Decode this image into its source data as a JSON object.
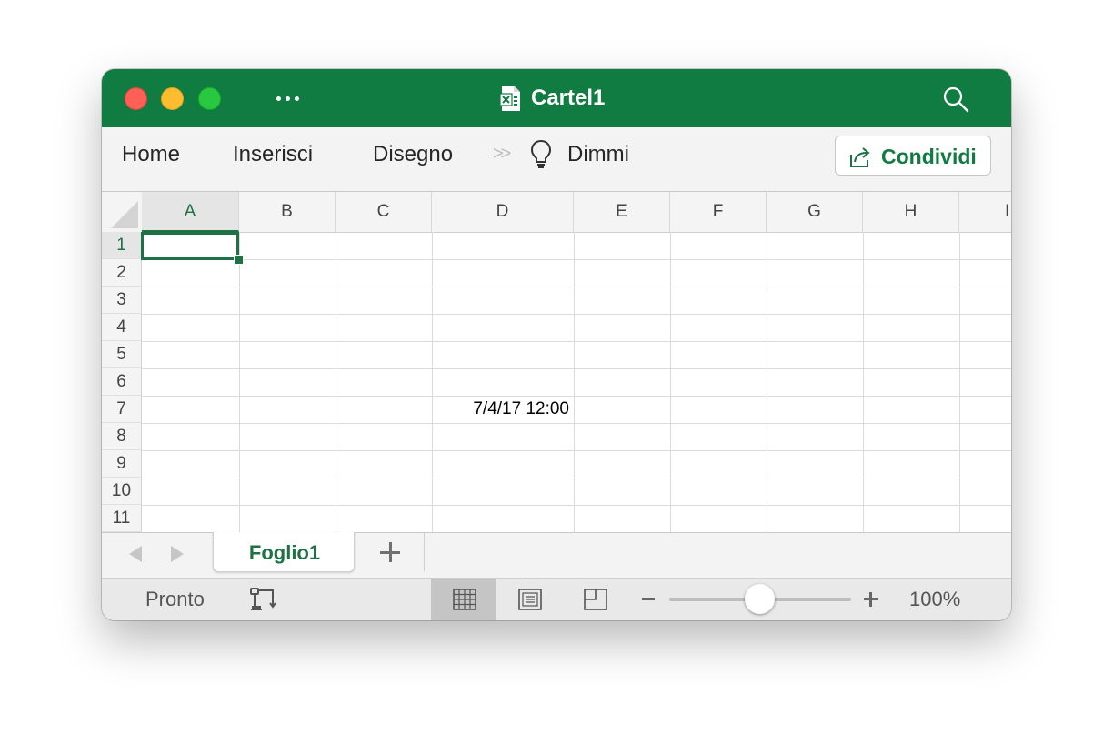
{
  "window": {
    "title": "Cartel1"
  },
  "ribbon": {
    "tabs": [
      "Home",
      "Inserisci",
      "Disegno"
    ],
    "more_chevron": "»",
    "tell_me": "Dimmi",
    "share_label": "Condividi"
  },
  "grid": {
    "columns": [
      "A",
      "B",
      "C",
      "D",
      "E",
      "F",
      "G",
      "H",
      "I"
    ],
    "rows": [
      "1",
      "2",
      "3",
      "4",
      "5",
      "6",
      "7",
      "8",
      "9",
      "10",
      "11"
    ],
    "selected_cell": "A1",
    "cells": {
      "D7": "7/4/17 12:00"
    }
  },
  "sheets": {
    "tabs": [
      "Foglio1"
    ],
    "active": "Foglio1"
  },
  "status": {
    "text": "Pronto",
    "zoom": "100%",
    "zoom_level": 1.0
  },
  "colors": {
    "accent": "#107c41",
    "selection": "#1e7145"
  },
  "icons": [
    "excel-doc-icon",
    "search-icon",
    "lightbulb-icon",
    "share-icon",
    "macro-record-icon",
    "normal-view-icon",
    "page-layout-view-icon",
    "page-break-view-icon"
  ]
}
